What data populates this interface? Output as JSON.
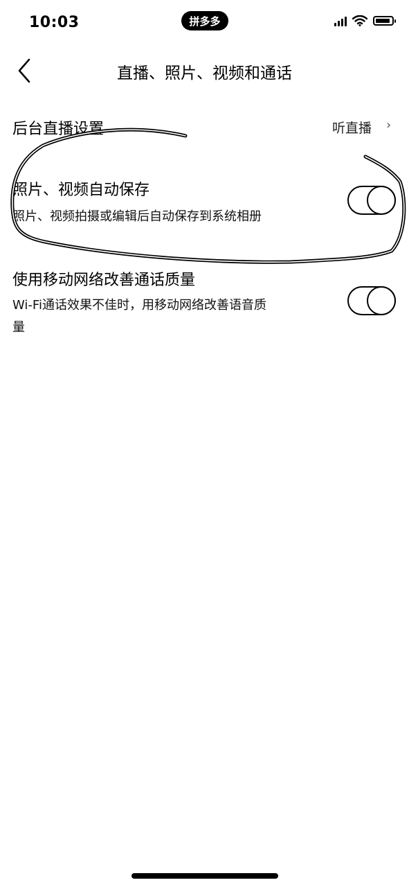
{
  "status_bar": {
    "time": "10:03",
    "app_badge": "拼多多",
    "icons": [
      "cellular-signal-icon",
      "wifi-icon",
      "battery-icon"
    ]
  },
  "nav": {
    "title": "直播、照片、视频和通话",
    "back_icon": "chevron-left-icon"
  },
  "rows": [
    {
      "title": "后台直播设置",
      "value": "听直播",
      "chevron": "›"
    },
    {
      "title": "照片、视频自动保存",
      "subtitle": "照片、视频拍摄或编辑后自动保存到系统相册",
      "toggle_on": false
    },
    {
      "title": "使用移动网络改善通话质量",
      "subtitle_line1": "Wi-Fi通话效果不佳时，用移动网络改善语音质",
      "subtitle_line2": "量",
      "toggle_on": false
    }
  ],
  "colors": {
    "background": "#ffffff",
    "foreground": "#000000"
  }
}
